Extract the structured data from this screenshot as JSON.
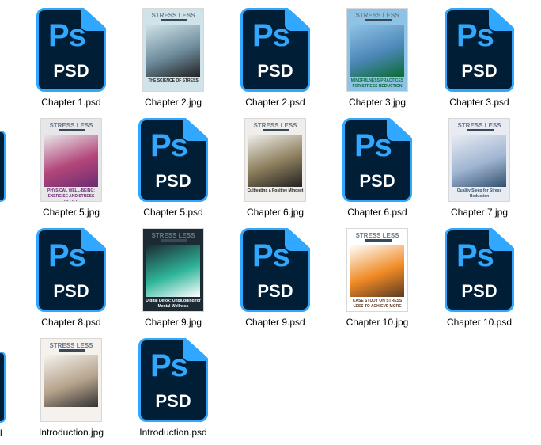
{
  "files": [
    {
      "name": "Chapter 1.psd",
      "type": "psd"
    },
    {
      "name": "Chapter 2.jpg",
      "type": "jpg",
      "brand": "STRESS LESS",
      "caption": "THE SCIENCE OF STRESS",
      "colors": [
        "#cfe3e8",
        "#6e8c9c",
        "#222"
      ]
    },
    {
      "name": "Chapter 2.psd",
      "type": "psd"
    },
    {
      "name": "Chapter 3.jpg",
      "type": "jpg",
      "brand": "STRESS LESS",
      "caption": "MINDFULNESS PRACTICES FOR STRESS REDUCTION",
      "colors": [
        "#8fc3e6",
        "#4c87b7",
        "#0a6b34"
      ]
    },
    {
      "name": "Chapter 3.psd",
      "type": "psd"
    },
    {
      "name": "Chapter 5.jpg",
      "type": "jpg",
      "brand": "STRESS LESS",
      "caption": "PHYSICAL WELL-BEING: EXERCISE AND STRESS RELIEF",
      "colors": [
        "#e7e7ea",
        "#b3467a",
        "#6a2d6f"
      ]
    },
    {
      "name": "Chapter 5.psd",
      "type": "psd"
    },
    {
      "name": "Chapter 6.jpg",
      "type": "jpg",
      "brand": "STRESS LESS",
      "caption": "Cultivating a Positive Mindset",
      "colors": [
        "#efeeea",
        "#8a7c5b",
        "#222"
      ]
    },
    {
      "name": "Chapter 6.psd",
      "type": "psd"
    },
    {
      "name": "Chapter 7.jpg",
      "type": "jpg",
      "brand": "STRESS LESS",
      "caption": "Quality Sleep for Stress Reduction",
      "colors": [
        "#e8ecf2",
        "#9fb5d2",
        "#33516f"
      ]
    },
    {
      "name": "Chapter 8.psd",
      "type": "psd"
    },
    {
      "name": "Chapter 9.jpg",
      "type": "jpg",
      "brand": "STRESS LESS",
      "caption": "Digital Detox: Unplugging for Mental Wellness",
      "colors": [
        "#1c2b33",
        "#2fb59a",
        "#ffffff"
      ]
    },
    {
      "name": "Chapter 9.psd",
      "type": "psd"
    },
    {
      "name": "Chapter 10.jpg",
      "type": "jpg",
      "brand": "STRESS LESS",
      "caption": "CASE STUDY ON STRESS LESS TO ACHIEVE MORE",
      "colors": [
        "#ffffff",
        "#f08a24",
        "#5b3a24"
      ]
    },
    {
      "name": "Chapter 10.psd",
      "type": "psd"
    },
    {
      "name": "Introduction.jpg",
      "type": "jpg",
      "brand": "STRESS LESS",
      "caption": "",
      "colors": [
        "#f5f2ee",
        "#b5a28a",
        "#333"
      ]
    },
    {
      "name": "Introduction.psd",
      "type": "psd"
    }
  ],
  "psd_icon": {
    "glyph": "Ps",
    "ext": "PSD"
  }
}
